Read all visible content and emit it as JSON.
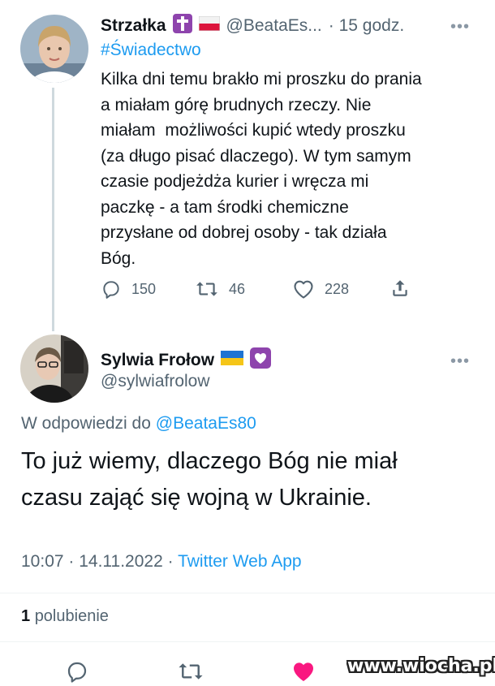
{
  "tweet1": {
    "display_name": "Strzałka",
    "handle": "@BeataEs...",
    "time": "· 15 godz.",
    "hashtag": "#Świadectwo",
    "lines": [
      "Kilka dni temu brakło mi proszku do prania",
      "a miałam górę brudnych rzeczy. Nie",
      "miałam  możliwości kupić wtedy proszku",
      "(za długo pisać dlaczego). W tym samym",
      "czasie podjeżdża kurier i wręcza mi",
      "paczkę - a tam środki chemiczne",
      "przysłane od dobrej osoby - tak działa",
      "Bóg."
    ],
    "replies": "150",
    "retweets": "46",
    "likes": "228"
  },
  "tweet2": {
    "display_name": "Sylwia Frołow",
    "handle": "@sylwiafrolow",
    "reply_prefix": "W odpowiedzi do",
    "reply_to": "@BeataEs80",
    "lines": [
      "To już wiemy, dlaczego Bóg nie miał",
      "czasu zająć się wojną w Ukrainie."
    ],
    "timestamp": "10:07 · 14.11.2022 ·",
    "source": "Twitter Web App",
    "like_count": "1",
    "like_label": "polubienie"
  },
  "watermark": "www.wiocha.pl",
  "colors": {
    "accent": "#1d9bf0",
    "muted": "#536471",
    "like": "#f91880",
    "badge_purple": "#8e44ad"
  },
  "icons": {
    "cross_badge": "latin-cross-icon",
    "flag_pl": "poland-flag-icon",
    "flag_ua": "ukraine-flag-icon",
    "heart_badge": "purple-heart-icon"
  }
}
